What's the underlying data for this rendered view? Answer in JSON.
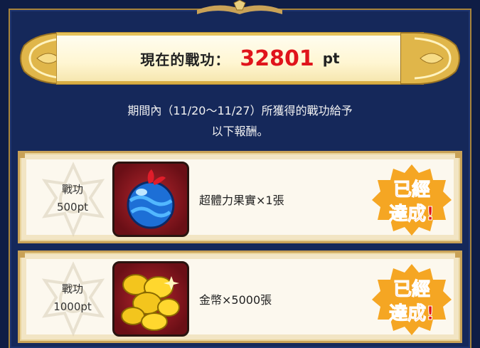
{
  "header": {
    "label": "現在的戰功：",
    "value": "32801",
    "unit": "pt",
    "value_color": "#e0141b"
  },
  "notice": {
    "line1": "期間內（11/20～11/27）所獲得的戰功給予",
    "line2": "以下報酬。"
  },
  "rewards": [
    {
      "req_label": "戰功",
      "req_value": "500pt",
      "item": "超體力果實×1張",
      "icon": "blue-fruit-icon",
      "status": "已經達成!"
    },
    {
      "req_label": "戰功",
      "req_value": "1000pt",
      "item": "金幣×5000張",
      "icon": "gold-coins-icon",
      "status": "已經達成!"
    }
  ],
  "colors": {
    "background": "#15285a",
    "gold": "#c9a257",
    "stamp_fill": "#f5a623",
    "stamp_text": "#e0141b"
  }
}
